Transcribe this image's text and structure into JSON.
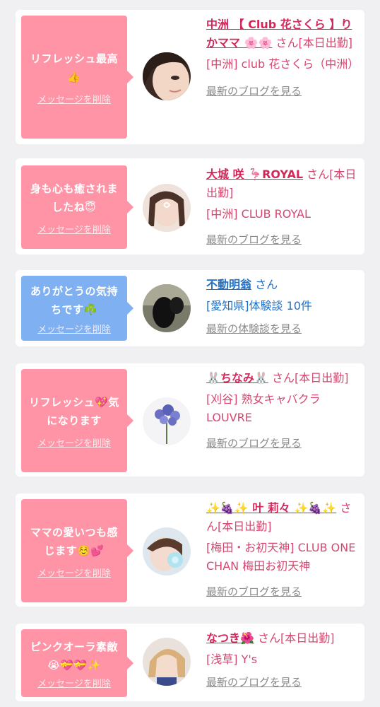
{
  "cards": [
    {
      "message": "リフレッシュ最高👍",
      "delete_label": "メッセージを削除",
      "name": "中洲 【 Club 花さくら 】りかママ 🌸🌸",
      "san": "さん[本日出勤]",
      "store": "[中洲] club 花さくら（中洲）",
      "link": "最新のブログを見る"
    },
    {
      "message": "身も心も癒されましたね😇",
      "delete_label": "メッセージを削除",
      "name": "大城 咲 🦩ROYAL",
      "san": "さん[本日出勤]",
      "store": "[中洲] CLUB ROYAL",
      "link": "最新のブログを見る"
    },
    {
      "message": "ありがとうの気持ちです☘️",
      "delete_label": "メッセージを削除",
      "name": "不動明翁",
      "san": "さん",
      "store": "[愛知県]体験談 10件",
      "link": "最新の体験談を見る"
    },
    {
      "message": "リフレッシュ💖気になります",
      "delete_label": "メッセージを削除",
      "name": "🐰ちなみ🐰",
      "san": "さん[本日出勤]",
      "store": "[刈谷] 熟女キャバクラ LOUVRE",
      "link": "最新のブログを見る"
    },
    {
      "message": "ママの愛いつも感じます☺️💕",
      "delete_label": "メッセージを削除",
      "name": "✨🍇✨ 叶 莉々 ✨🍇✨",
      "san": "さん[本日出勤]",
      "store": "[梅田・お初天神] CLUB ONE CHAN 梅田お初天神",
      "link": "最新のブログを見る"
    },
    {
      "message": "ピンクオーラ素敵😭💝💝✨",
      "delete_label": "メッセージを削除",
      "name": "なつき🌺",
      "san": "さん[本日出勤]",
      "store": "[浅草] Y's",
      "link": "最新のブログを見る"
    }
  ],
  "colors": {
    "bubble_pink": "#ff94a7",
    "bubble_blue": "#7fb0f2",
    "name_pink": "#d4285a",
    "name_blue": "#1f6fc5",
    "link_gray": "#8a8a8a"
  }
}
